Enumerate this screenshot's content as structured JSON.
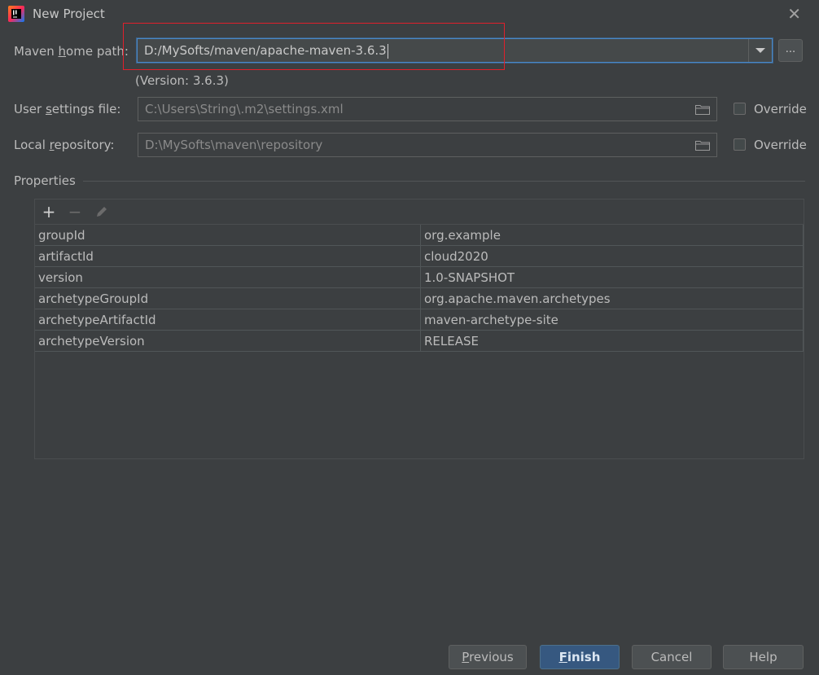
{
  "window": {
    "title": "New Project"
  },
  "maven": {
    "home_label_pre": "Maven ",
    "home_label_mn": "h",
    "home_label_post": "ome path:",
    "home_value": "D:/MySofts/maven/apache-maven-3.6.3",
    "browse_label": "...",
    "version_text": "(Version: 3.6.3)"
  },
  "user_settings": {
    "label_pre": "User ",
    "label_mn": "s",
    "label_post": "ettings file:",
    "value": "C:\\Users\\String\\.m2\\settings.xml",
    "override_label": "Override",
    "override_checked": false
  },
  "local_repo": {
    "label_pre": "Local ",
    "label_mn": "r",
    "label_post": "epository:",
    "value": "D:\\MySofts\\maven\\repository",
    "override_label": "Override",
    "override_checked": false
  },
  "properties": {
    "title": "Properties",
    "toolbar": {
      "add": "+",
      "remove": "−"
    },
    "rows": [
      {
        "key": "groupId",
        "value": "org.example"
      },
      {
        "key": "artifactId",
        "value": "cloud2020"
      },
      {
        "key": "version",
        "value": "1.0-SNAPSHOT"
      },
      {
        "key": "archetypeGroupId",
        "value": "org.apache.maven.archetypes"
      },
      {
        "key": "archetypeArtifactId",
        "value": "maven-archetype-site"
      },
      {
        "key": "archetypeVersion",
        "value": "RELEASE"
      }
    ]
  },
  "footer": {
    "previous_mn": "P",
    "previous_rest": "revious",
    "finish_mn": "F",
    "finish_rest": "inish",
    "cancel": "Cancel",
    "help": "Help"
  },
  "colors": {
    "accent": "#4a88c7",
    "highlight_box": "#e0202c",
    "primary_button": "#365880"
  },
  "icons": [
    "intellij-app-icon",
    "close-icon",
    "dropdown-arrow-icon",
    "folder-icon",
    "add-icon",
    "remove-icon",
    "edit-icon"
  ]
}
